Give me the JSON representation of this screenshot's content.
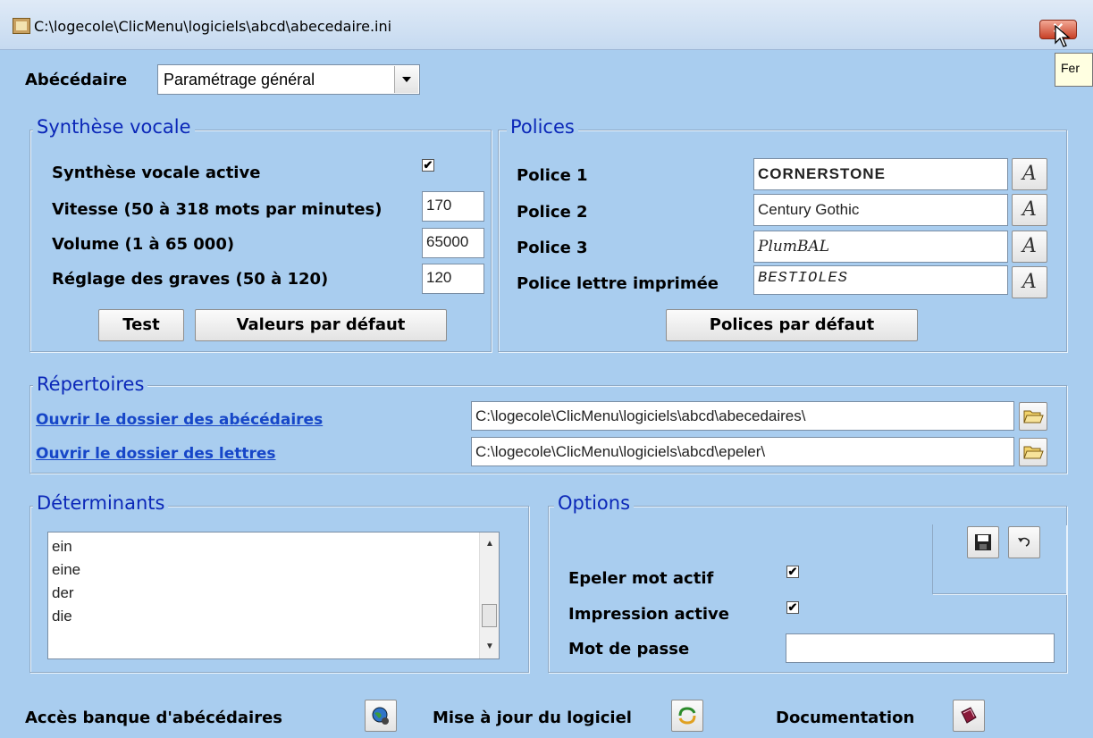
{
  "window": {
    "title": "C:\\logecole\\ClicMenu\\logiciels\\abcd\\abecedaire.ini",
    "close_label": "✕",
    "tooltip": "Fer"
  },
  "header": {
    "abecedaire_label": "Abécédaire",
    "abecedaire_select_value": "Paramétrage général"
  },
  "synthese": {
    "title": "Synthèse vocale",
    "active_label": "Synthèse vocale active",
    "active_checked": "✔",
    "vitesse_label": "Vitesse (50 à 318 mots par minutes)",
    "vitesse_value": "170",
    "volume_label": "Volume (1 à 65 000)",
    "volume_value": "65000",
    "graves_label": "Réglage des graves (50 à 120)",
    "graves_value": "120",
    "test_button": "Test",
    "defaults_button": "Valeurs par défaut"
  },
  "polices": {
    "title": "Polices",
    "police1_label": "Police 1",
    "police1_value": "CORNERSTONE",
    "police2_label": "Police 2",
    "police2_value": "Century Gothic",
    "police3_label": "Police 3",
    "police3_value": "PlumBAL",
    "police_lettre_label": "Police lettre imprimée",
    "police_lettre_value": "BESTIOLES",
    "font_button_glyph": "A",
    "defaults_button": "Polices par défaut"
  },
  "repertoires": {
    "title": "Répertoires",
    "abecedaires_link": "Ouvrir le dossier des abécédaires",
    "abecedaires_path": "C:\\logecole\\ClicMenu\\logiciels\\abcd\\abecedaires\\",
    "lettres_link": "Ouvrir le dossier des lettres",
    "lettres_path": "C:\\logecole\\ClicMenu\\logiciels\\abcd\\epeler\\"
  },
  "determinants": {
    "title": "Déterminants",
    "items": [
      "ein",
      "eine",
      "der",
      "die"
    ]
  },
  "options": {
    "title": "Options",
    "epeler_label": "Epeler mot actif",
    "epeler_checked": "✔",
    "impression_label": "Impression active",
    "impression_checked": "✔",
    "motdepasse_label": "Mot de passe",
    "motdepasse_value": ""
  },
  "footer": {
    "banque_label": "Accès banque d'abécédaires",
    "maj_label": "Mise à jour du logiciel",
    "doc_label": "Documentation"
  },
  "icons": {
    "folder": "folder-open-icon",
    "save": "floppy-disk-icon",
    "undo": "undo-icon",
    "globe": "globe-icon",
    "update": "update-icon",
    "book": "book-icon"
  }
}
